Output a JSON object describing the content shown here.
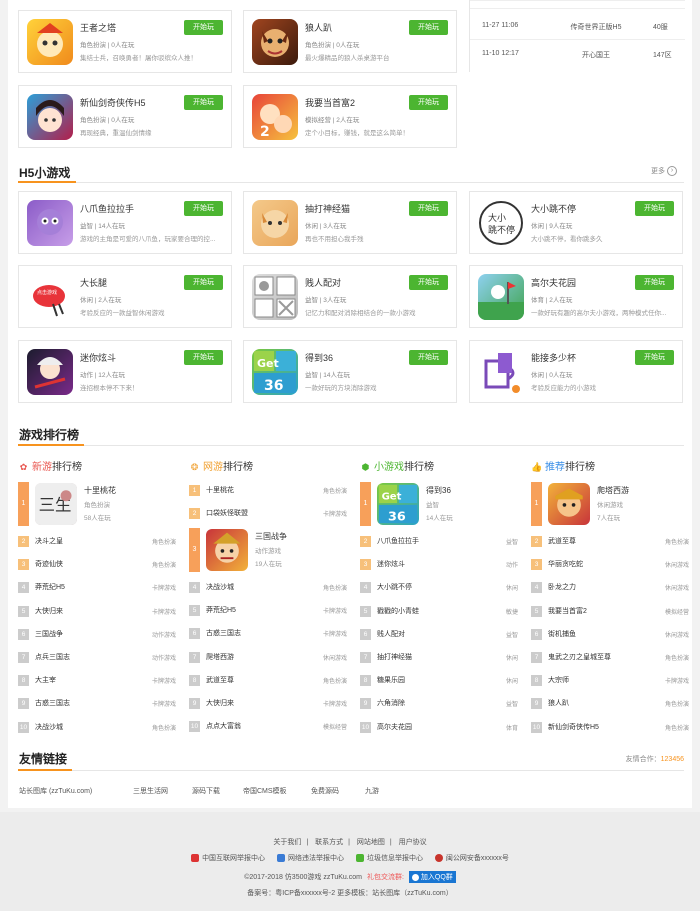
{
  "top_cards": [
    {
      "name": "王者之塔",
      "meta": "角色扮演 | 0人在玩",
      "desc": "集结士兵，召唤勇者！屠你驳缤众人推！",
      "play": "开始玩",
      "icon": "wangzhe-icon"
    },
    {
      "name": "狼人趴",
      "meta": "角色扮演 | 0人在玩",
      "desc": "最火爆精品的狼人杀桌游平台",
      "play": "开始玩",
      "icon": "langren-icon"
    },
    {
      "name": "新仙剑奇侠传H5",
      "meta": "角色扮演 | 0人在玩",
      "desc": "再现经典，重温仙剑情缘",
      "play": "开始玩",
      "icon": "xianjian-icon"
    },
    {
      "name": "我要当首富2",
      "meta": "模拟经营 | 2人在玩",
      "desc": "定个小目标，赚钱，就是这么简单！",
      "play": "开始玩",
      "icon": "shoufu-icon"
    }
  ],
  "news": [
    {
      "date": "11-27 11:06",
      "title": "传奇世界正版H5",
      "server": "40服"
    },
    {
      "date": "11-10 12:17",
      "title": "开心国王",
      "server": "147区"
    }
  ],
  "h5": {
    "title": "H5小游戏",
    "more": "更多",
    "cards": [
      {
        "name": "八爪鱼拉拉手",
        "meta": "益智 | 14人在玩",
        "desc": "游戏的主角是可爱的八爪鱼，玩家要合理的控...",
        "play": "开始玩",
        "icon": "octopus-icon"
      },
      {
        "name": "抽打神经猫",
        "meta": "休闲 | 3人在玩",
        "desc": "再也不用担心我手残",
        "play": "开始玩",
        "icon": "cat-icon"
      },
      {
        "name": "大小跳不停",
        "meta": "休闲 | 9人在玩",
        "desc": "大小跳不停，看你跳多久",
        "play": "开始玩",
        "icon": "jump-icon"
      },
      {
        "name": "大长腿",
        "meta": "休闲 | 2人在玩",
        "desc": "考验反应的一款益智休闲游戏",
        "play": "开始玩",
        "icon": "legs-icon"
      },
      {
        "name": "贱人配对",
        "meta": "益智 | 3人在玩",
        "desc": "记忆力和配对消除相结合的一款小游戏",
        "play": "开始玩",
        "icon": "pair-icon"
      },
      {
        "name": "高尔夫花园",
        "meta": "体育 | 2人在玩",
        "desc": "一款好玩有趣的高尔夫小游戏，两种模式任你...",
        "play": "开始玩",
        "icon": "golf-icon"
      },
      {
        "name": "迷你炫斗",
        "meta": "动作 | 12人在玩",
        "desc": "连招根本停不下来！",
        "play": "开始玩",
        "icon": "fight-icon"
      },
      {
        "name": "得到36",
        "meta": "益智 | 14人在玩",
        "desc": "一款好玩的方块消除游戏",
        "play": "开始玩",
        "icon": "get36-icon"
      },
      {
        "name": "能接多少杯",
        "meta": "休闲 | 0人在玩",
        "desc": "考验反应能力的小游戏",
        "play": "开始玩",
        "icon": "cup-icon"
      }
    ]
  },
  "rank": {
    "title": "游戏排行榜",
    "cols": [
      {
        "hl": "新游",
        "rest": "排行榜",
        "color": "#e8554e",
        "icon": "gift-icon",
        "top": {
          "name": "十里桃花",
          "cat": "角色扮演",
          "players": "58人在玩",
          "icon": "taohua-icon"
        },
        "items": [
          {
            "n": "决斗之皇",
            "c": "角色扮演"
          },
          {
            "n": "奇迹仙侠",
            "c": "角色扮演"
          },
          {
            "n": "莽荒纪H5",
            "c": "卡牌游戏"
          },
          {
            "n": "大侠归来",
            "c": "卡牌游戏"
          },
          {
            "n": "三国战争",
            "c": "动作游戏"
          },
          {
            "n": "点兵三国志",
            "c": "动作游戏"
          },
          {
            "n": "大主宰",
            "c": "卡牌游戏"
          },
          {
            "n": "古惑三国志",
            "c": "卡牌游戏"
          },
          {
            "n": "决战沙城",
            "c": "角色扮演"
          }
        ]
      },
      {
        "hl": "网游",
        "rest": "排行榜",
        "color": "#f0a030",
        "icon": "ball-icon",
        "top": null,
        "items2": [
          {
            "n": "十里桃花",
            "c": "角色扮演"
          },
          {
            "n": "口袋妖怪联盟",
            "c": "卡牌游戏"
          }
        ],
        "top3": {
          "name": "三国战争",
          "cat": "动作游戏",
          "players": "19人在玩",
          "icon": "sanguo-icon"
        },
        "items": [
          {
            "n": "决战沙城",
            "c": "角色扮演"
          },
          {
            "n": "莽荒纪H5",
            "c": "卡牌游戏"
          },
          {
            "n": "古惑三国志",
            "c": "卡牌游戏"
          },
          {
            "n": "爬塔西游",
            "c": "休闲游戏"
          },
          {
            "n": "武道至尊",
            "c": "角色扮演"
          },
          {
            "n": "大侠归来",
            "c": "卡牌游戏"
          },
          {
            "n": "点点大富翁",
            "c": "模拟经营"
          }
        ]
      },
      {
        "hl": "小游戏",
        "rest": "排行榜",
        "color": "#4cb531",
        "icon": "html5-icon",
        "top": {
          "name": "得到36",
          "cat": "益智",
          "players": "14人在玩",
          "icon": "get36-icon"
        },
        "items": [
          {
            "n": "八爪鱼拉拉手",
            "c": "益智"
          },
          {
            "n": "迷你炫斗",
            "c": "动作"
          },
          {
            "n": "大小跳不停",
            "c": "休闲"
          },
          {
            "n": "戳戳的小青蛙",
            "c": "敏捷"
          },
          {
            "n": "贱人配对",
            "c": "益智"
          },
          {
            "n": "抽打神经猫",
            "c": "休闲"
          },
          {
            "n": "糖果乐园",
            "c": "休闲"
          },
          {
            "n": "六角消除",
            "c": "益智"
          },
          {
            "n": "高尔夫花园",
            "c": "体育"
          }
        ]
      },
      {
        "hl": "推荐",
        "rest": "排行榜",
        "color": "#3a8ee6",
        "icon": "thumb-icon",
        "top": {
          "name": "爬塔西游",
          "cat": "休闲游戏",
          "players": "7人在玩",
          "icon": "xiyou-icon"
        },
        "items": [
          {
            "n": "武道至尊",
            "c": "角色扮演"
          },
          {
            "n": "华丽贪吃蛇",
            "c": "休闲游戏"
          },
          {
            "n": "卧龙之力",
            "c": "休闲游戏"
          },
          {
            "n": "我要当首富2",
            "c": "模拟经营"
          },
          {
            "n": "街机捕鱼",
            "c": "休闲游戏"
          },
          {
            "n": "鬼武之刃之皇城至尊",
            "c": "角色扮演"
          },
          {
            "n": "大宗师",
            "c": "卡牌游戏"
          },
          {
            "n": "狼人趴",
            "c": "角色扮演"
          },
          {
            "n": "新仙剑奇侠传H5",
            "c": "角色扮演"
          }
        ]
      }
    ]
  },
  "links": {
    "title": "友情链接",
    "partner_label": "友情合作：",
    "partner_qq": "123456",
    "items": [
      "站长图库 (zzTuKu.com)",
      "三思生活网",
      "源码下载",
      "帝国CMS模板",
      "免费源码",
      "九游"
    ]
  },
  "footer": {
    "nav": [
      "关于我们",
      "联系方式",
      "网站地图",
      "用户协议"
    ],
    "badges": [
      "中国互联网举报中心",
      "网络违法举报中心",
      "垃圾信息举报中心",
      "闽公网安备xxxxxx号"
    ],
    "copyright": "©2017-2018  仿3500游戏  zzTuKu.com",
    "gift": "礼包交流群:",
    "qq": "加入QQ群",
    "icp": "备案号：粤ICP备xxxxxx号-2  更多模板：站长图库（zzTuKu.com）"
  }
}
